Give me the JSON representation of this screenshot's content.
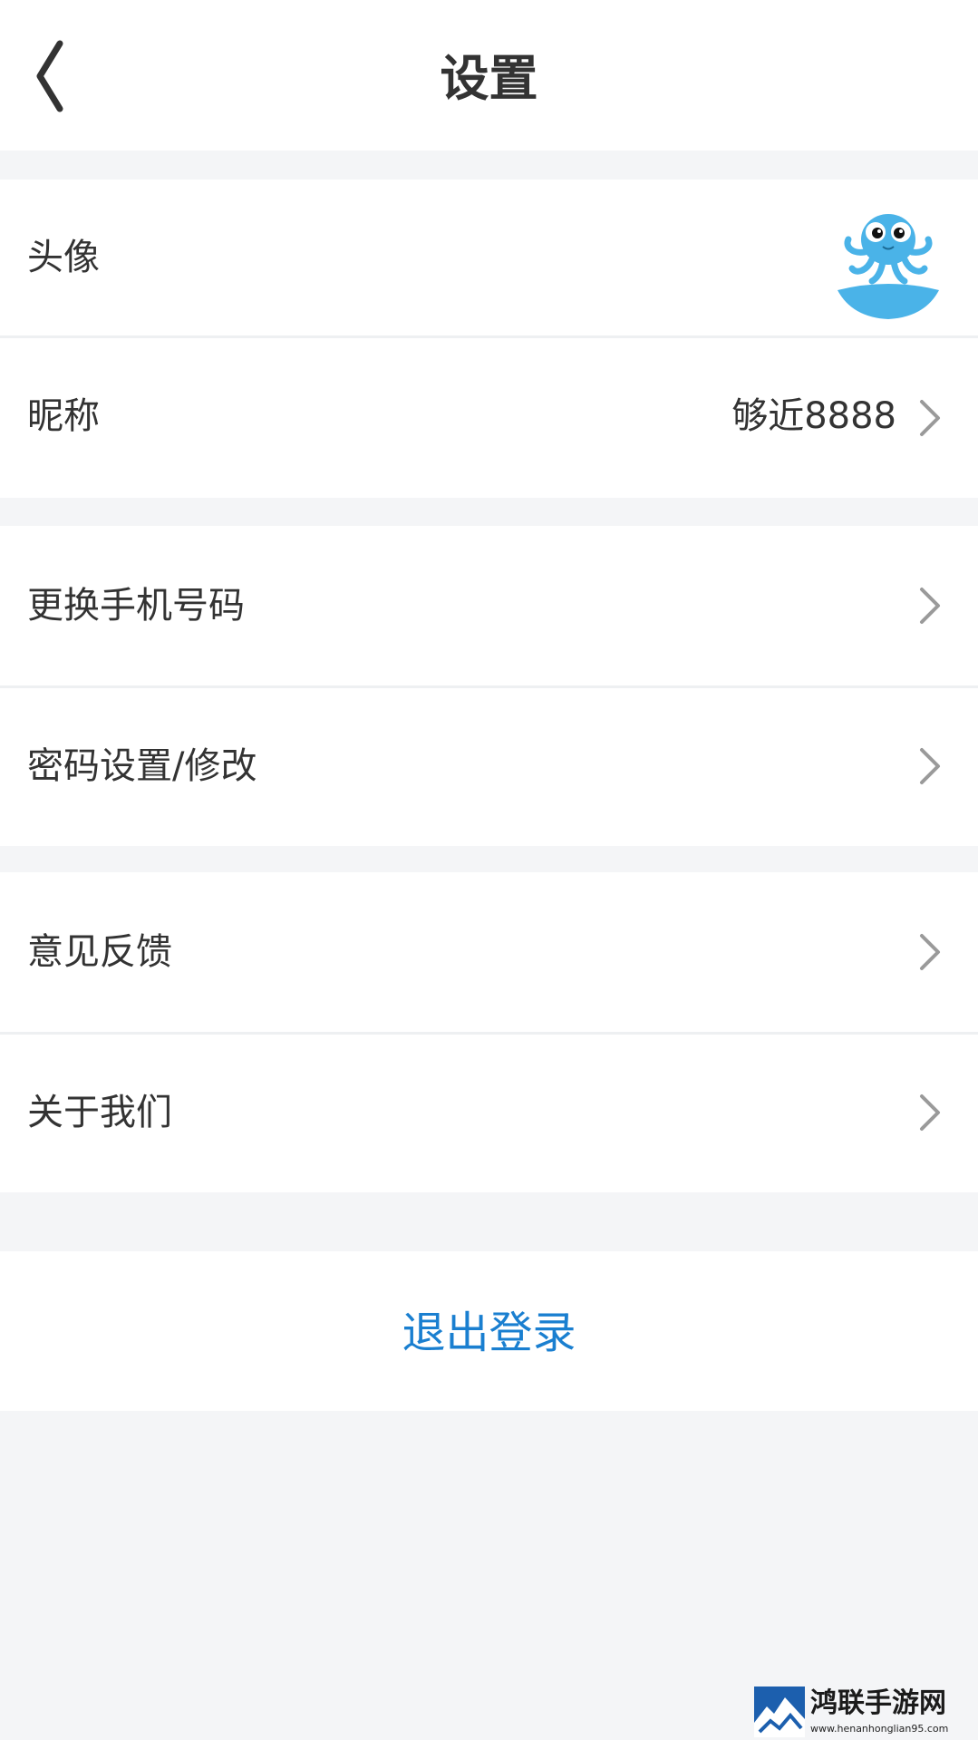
{
  "header": {
    "title": "设置",
    "back_icon": "chevron-left-icon"
  },
  "profile": {
    "avatar_label": "头像",
    "avatar_icon": "octopus-avatar",
    "nickname_label": "昵称",
    "nickname_value": "够近8888"
  },
  "account": {
    "change_phone_label": "更换手机号码",
    "password_label": "密码设置/修改"
  },
  "about": {
    "feedback_label": "意见反馈",
    "about_us_label": "关于我们"
  },
  "logout": {
    "label": "退出登录"
  },
  "watermark": {
    "title": "鸿联手游网",
    "url": "www.henanhonglian95.com"
  },
  "colors": {
    "background": "#f4f5f7",
    "row": "#ffffff",
    "text": "#333333",
    "chevron": "#9a9a9a",
    "logout": "#1a7fd0",
    "avatar_blue": "#4ab3e8"
  }
}
